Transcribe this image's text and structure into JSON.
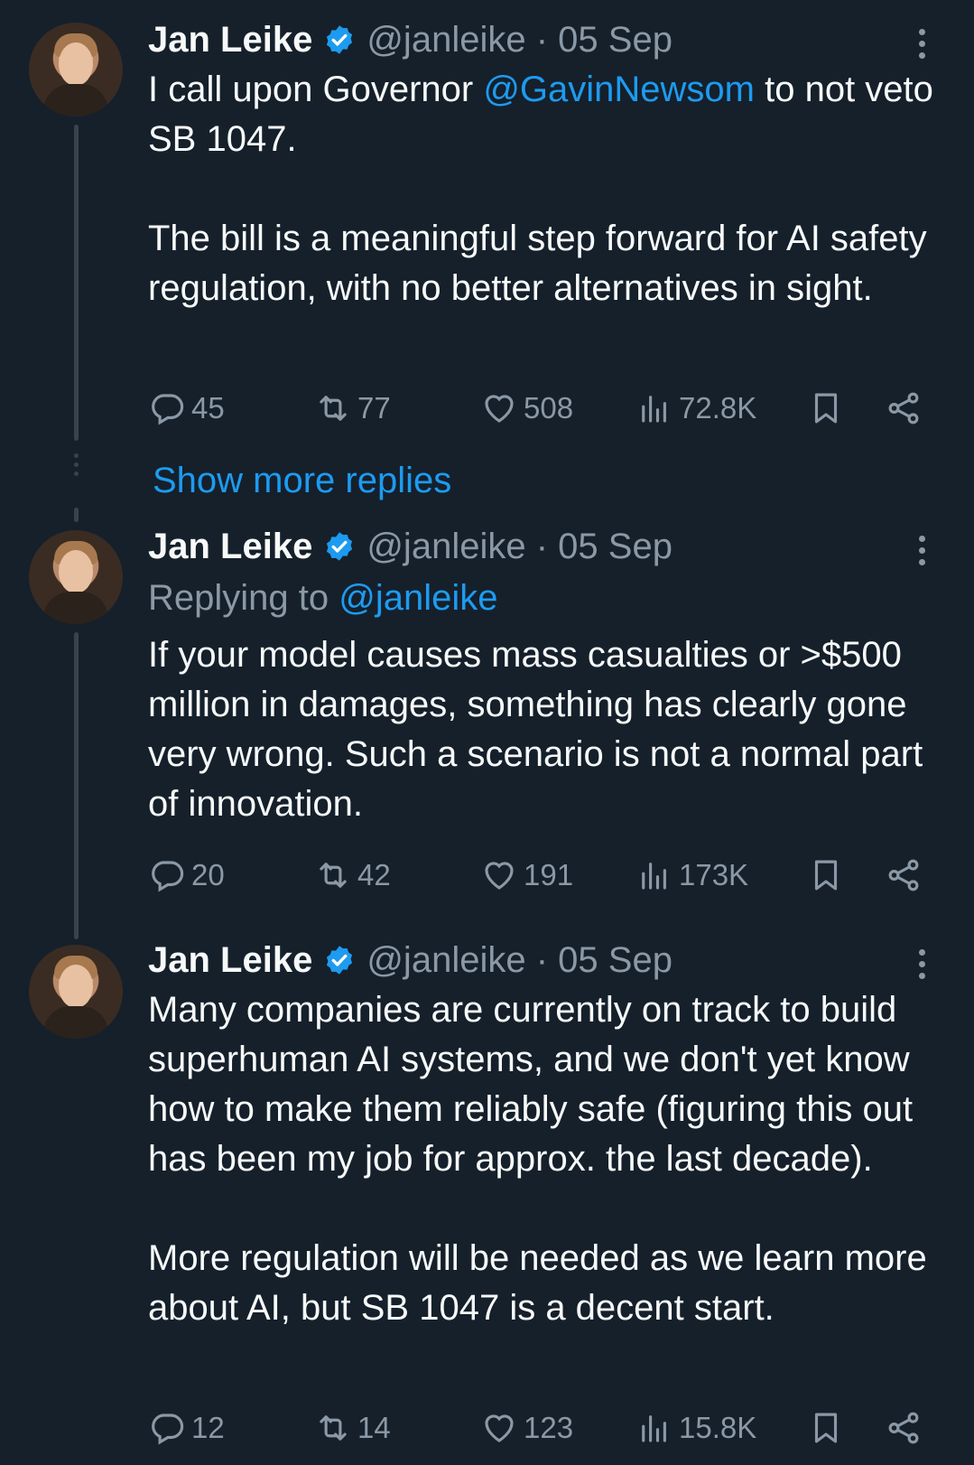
{
  "colors": {
    "background": "#15202b",
    "text": "#f7f9f9",
    "muted": "#8b98a5",
    "accent": "#1d9bf0",
    "thread_line": "#38444d"
  },
  "tweets": [
    {
      "name": "Jan Leike",
      "handle": "@janleike",
      "sep": "·",
      "date": "05 Sep",
      "text_before_mention": "I call upon Governor ",
      "mention": "@GavinNewsom",
      "text_after_mention": " to not veto SB 1047.",
      "paragraph2": "The bill is a meaningful step forward for AI safety regulation, with no better alternatives in sight.",
      "replies": "45",
      "reposts": "77",
      "likes": "508",
      "views": "72.8K"
    },
    {
      "name": "Jan Leike",
      "handle": "@janleike",
      "sep": "·",
      "date": "05 Sep",
      "replying_to_label": "Replying to ",
      "replying_to_handle": "@janleike",
      "paragraph1": "If your model causes mass casualties or >$500 million in damages, something has clearly gone very wrong. Such a scenario is not a normal part of innovation.",
      "replies": "20",
      "reposts": "42",
      "likes": "191",
      "views": "173K"
    },
    {
      "name": "Jan Leike",
      "handle": "@janleike",
      "sep": "·",
      "date": "05 Sep",
      "paragraph1": "Many companies are currently on track to build superhuman AI systems, and we don't yet know how to make them reliably safe (figuring this out has been my job for approx. the last decade).",
      "paragraph2": "More regulation will be needed as we learn more about AI, but SB 1047 is a decent start.",
      "replies": "12",
      "reposts": "14",
      "likes": "123",
      "views": "15.8K"
    }
  ],
  "show_more_replies": "Show more replies",
  "icons": [
    "verified-badge-icon",
    "more-options-icon",
    "reply-icon",
    "repost-icon",
    "like-icon",
    "views-icon",
    "bookmark-icon",
    "share-icon"
  ]
}
